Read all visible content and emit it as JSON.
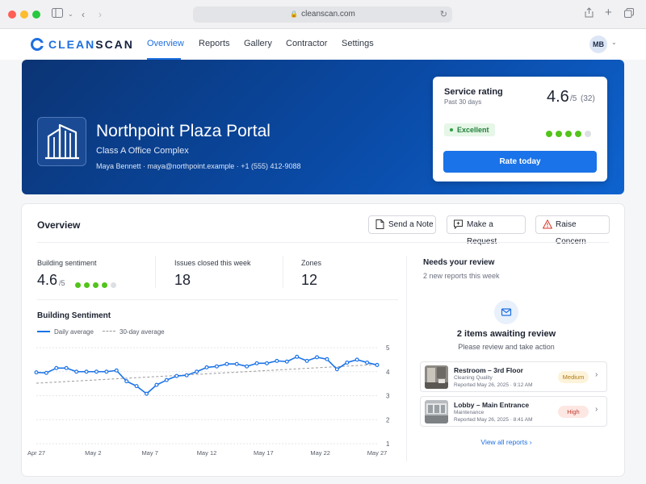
{
  "browser": {
    "url": "cleanscan.com"
  },
  "brand": {
    "name_light": "CLEAN",
    "name_bold": "SCAN",
    "accent": "#1e6fe0"
  },
  "nav": {
    "tabs": [
      {
        "label": "Overview",
        "active": true
      },
      {
        "label": "Reports",
        "active": false
      },
      {
        "label": "Gallery",
        "active": false
      },
      {
        "label": "Contractor",
        "active": false
      },
      {
        "label": "Settings",
        "active": false
      }
    ],
    "user_initials": "MB"
  },
  "hero": {
    "title": "Northpoint Plaza Portal",
    "subtitle": "Class A Office Complex",
    "contact": "Maya Bennett · maya@northpoint.example · +1 (555) 412-9088",
    "icon": "building-icon"
  },
  "rating_card": {
    "title": "Service rating",
    "period": "Past 30 days",
    "score": "4.6",
    "suffix": "/5",
    "count": "(32)",
    "badge": "Excellent",
    "badge_color": "#21803a",
    "dots_filled": 4,
    "dots_total": 5,
    "button": "Rate today"
  },
  "overview": {
    "title": "Overview",
    "actions": {
      "note": "Send a Note",
      "request": "Make a Request",
      "concern": "Raise Concern"
    },
    "stats": {
      "sentiment_label": "Building sentiment",
      "sentiment_value": "4.6",
      "sentiment_suffix": "/5",
      "issues_label": "Issues closed this week",
      "issues_value": "18",
      "zones_label": "Zones",
      "zones_value": "12"
    }
  },
  "chart_data": {
    "type": "line",
    "title": "Building Sentiment",
    "xlabel": "",
    "ylabel": "",
    "x_ticks": [
      "Apr 27",
      "May 2",
      "May 7",
      "May 12",
      "May 17",
      "May 22",
      "May 27"
    ],
    "y_ticks": [
      1,
      2,
      3,
      4,
      5
    ],
    "ylim": [
      1,
      5
    ],
    "grid": true,
    "series": [
      {
        "name": "Daily average",
        "color": "#1a73e8",
        "style": "solid",
        "values": [
          3.97,
          3.95,
          4.15,
          4.15,
          4.0,
          4.0,
          4.0,
          4.0,
          4.05,
          3.6,
          3.4,
          3.08,
          3.45,
          3.65,
          3.82,
          3.85,
          4.0,
          4.18,
          4.22,
          4.32,
          4.32,
          4.22,
          4.35,
          4.35,
          4.45,
          4.42,
          4.62,
          4.45,
          4.6,
          4.52,
          4.1,
          4.38,
          4.5,
          4.38,
          4.28
        ]
      },
      {
        "name": "30-day average",
        "color": "#999999",
        "style": "dashed",
        "values": [
          3.52,
          4.3
        ]
      }
    ],
    "legend": "top-left"
  },
  "review": {
    "title": "Needs your review",
    "subtitle": "2 new reports this week",
    "heading": "2 items awaiting review",
    "description": "Please review and take action",
    "items": [
      {
        "name": "Restroom – 3rd Floor",
        "category": "Cleaning Quality",
        "date": "Reported May 26, 2025 · 9:12 AM",
        "priority": "Medium"
      },
      {
        "name": "Lobby – Main Entrance",
        "category": "Maintenance",
        "date": "Reported May 26, 2025 · 8:41 AM",
        "priority": "High"
      }
    ],
    "link": "View all reports"
  }
}
